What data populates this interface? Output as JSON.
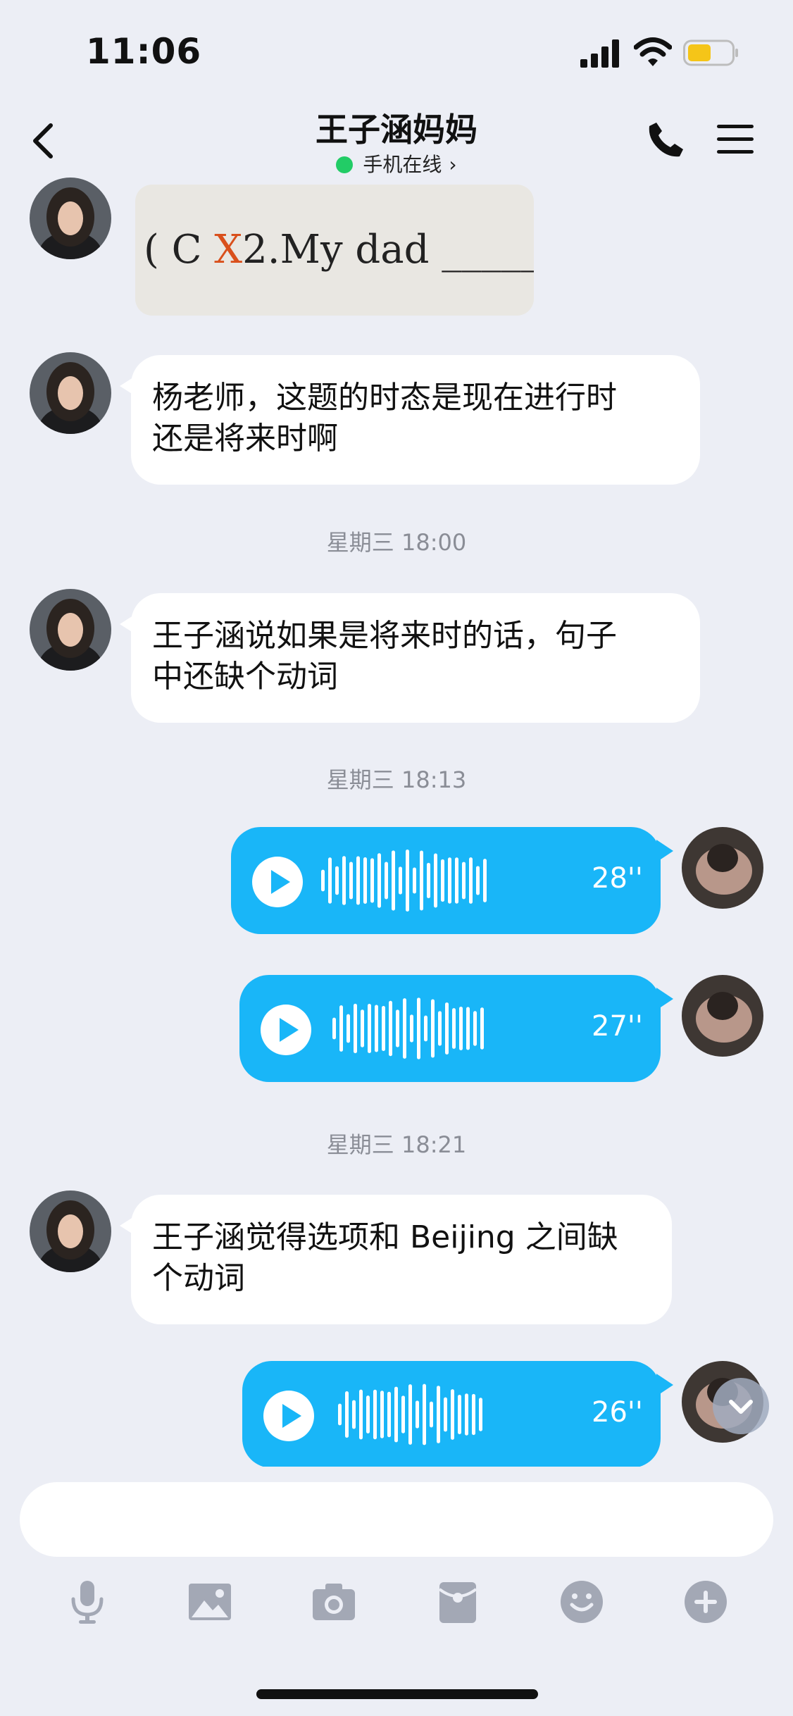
{
  "status_bar": {
    "time": "11:06"
  },
  "header": {
    "title": "王子涵妈妈",
    "status": "手机在线",
    "status_chevron": "›"
  },
  "messages": {
    "image_ocr": {
      "mark1": "( C ",
      "crossed": "X",
      "text": "2.My dad ______"
    },
    "m1": {
      "line1": "杨老师，这题的时态是现在进行时",
      "line2": "还是将来时啊"
    },
    "ts1": "星期三 18:00",
    "m2": {
      "line1": "王子涵说如果是将来时的话，句子",
      "line2": "中还缺个动词"
    },
    "ts2": "星期三 18:13",
    "v1": {
      "duration": "28''"
    },
    "v2": {
      "duration": "27''"
    },
    "ts3": "星期三 18:21",
    "m3": {
      "line1": "王子涵觉得选项和 Beijing 之间缺",
      "line2": "个动词"
    },
    "v3": {
      "duration": "26''"
    }
  },
  "input": {
    "placeholder": ""
  },
  "icons": {
    "toolbar": [
      "microphone-icon",
      "image-icon",
      "camera-icon",
      "red-packet-icon",
      "emoji-icon",
      "plus-icon"
    ]
  },
  "colors": {
    "voice_bubble": "#19b6f8",
    "background": "#eceef5",
    "online": "#22cc66"
  }
}
